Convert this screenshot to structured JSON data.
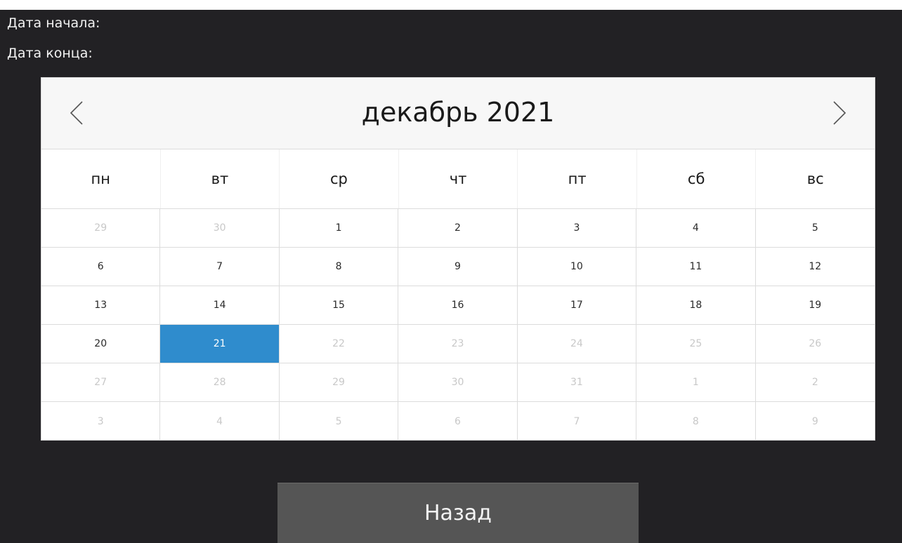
{
  "labels": {
    "start_date": "Дата начала:",
    "end_date": "Дата конца:"
  },
  "calendar": {
    "month_title": "декабрь 2021",
    "prev_icon": "chevron-left-icon",
    "next_icon": "chevron-right-icon",
    "weekdays": [
      "пн",
      "вт",
      "ср",
      "чт",
      "пт",
      "сб",
      "вс"
    ],
    "selected_day": "21",
    "selected_color": "#2f8ccd",
    "days": [
      {
        "label": "29",
        "muted": true
      },
      {
        "label": "30",
        "muted": true
      },
      {
        "label": "1",
        "muted": false
      },
      {
        "label": "2",
        "muted": false
      },
      {
        "label": "3",
        "muted": false
      },
      {
        "label": "4",
        "muted": false
      },
      {
        "label": "5",
        "muted": false
      },
      {
        "label": "6",
        "muted": false
      },
      {
        "label": "7",
        "muted": false
      },
      {
        "label": "8",
        "muted": false
      },
      {
        "label": "9",
        "muted": false
      },
      {
        "label": "10",
        "muted": false
      },
      {
        "label": "11",
        "muted": false
      },
      {
        "label": "12",
        "muted": false
      },
      {
        "label": "13",
        "muted": false
      },
      {
        "label": "14",
        "muted": false
      },
      {
        "label": "15",
        "muted": false
      },
      {
        "label": "16",
        "muted": false
      },
      {
        "label": "17",
        "muted": false
      },
      {
        "label": "18",
        "muted": false
      },
      {
        "label": "19",
        "muted": false
      },
      {
        "label": "20",
        "muted": false
      },
      {
        "label": "21",
        "muted": false,
        "selected": true
      },
      {
        "label": "22",
        "muted": true
      },
      {
        "label": "23",
        "muted": true
      },
      {
        "label": "24",
        "muted": true
      },
      {
        "label": "25",
        "muted": true
      },
      {
        "label": "26",
        "muted": true
      },
      {
        "label": "27",
        "muted": true
      },
      {
        "label": "28",
        "muted": true
      },
      {
        "label": "29",
        "muted": true
      },
      {
        "label": "30",
        "muted": true
      },
      {
        "label": "31",
        "muted": true
      },
      {
        "label": "1",
        "muted": true
      },
      {
        "label": "2",
        "muted": true
      },
      {
        "label": "3",
        "muted": true
      },
      {
        "label": "4",
        "muted": true
      },
      {
        "label": "5",
        "muted": true
      },
      {
        "label": "6",
        "muted": true
      },
      {
        "label": "7",
        "muted": true
      },
      {
        "label": "8",
        "muted": true
      },
      {
        "label": "9",
        "muted": true
      }
    ]
  },
  "buttons": {
    "back_label": "Назад"
  }
}
